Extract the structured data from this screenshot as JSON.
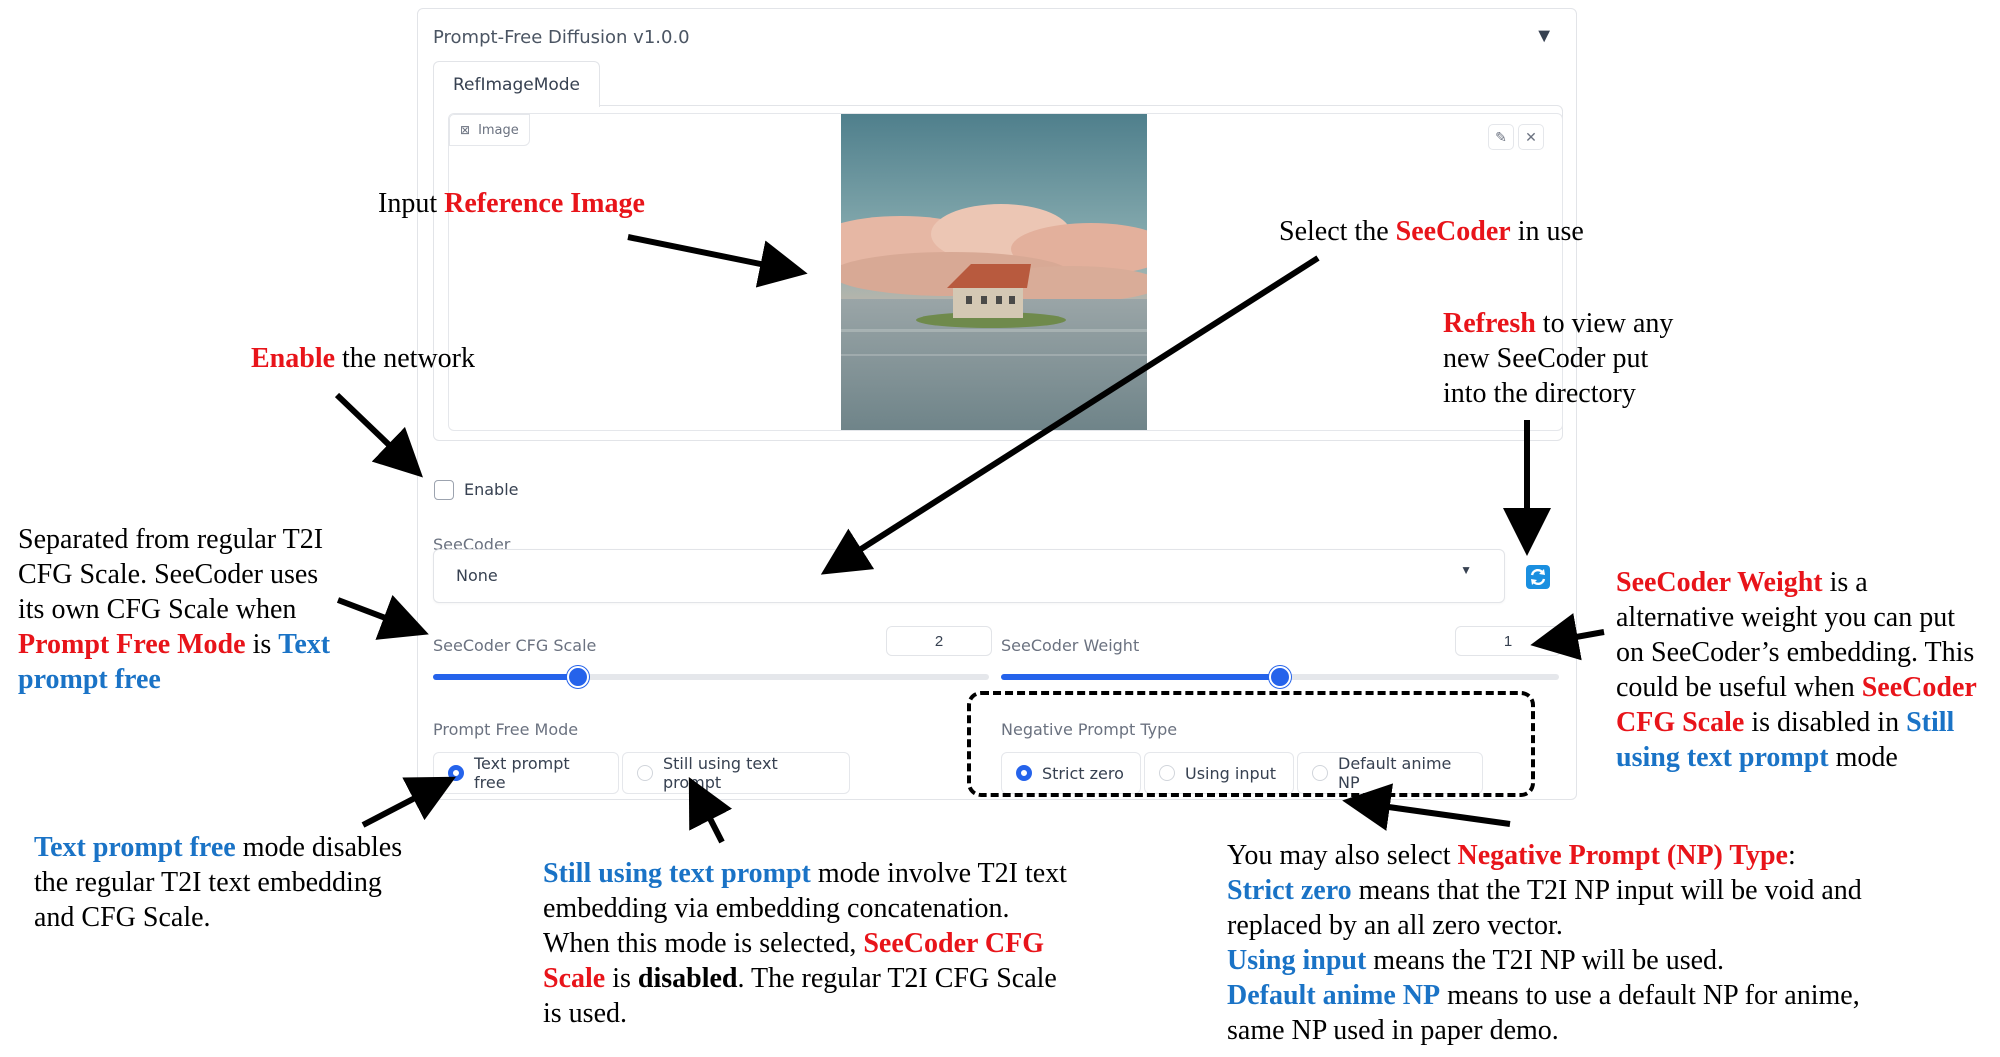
{
  "panel": {
    "title": "Prompt-Free Diffusion v1.0.0",
    "collapse_icon": "triangle-down-icon",
    "tab_label": "RefImageMode",
    "image_label": "Image",
    "enable_label": "Enable",
    "seecoder_label": "SeeCoder",
    "seecoder_value": "None",
    "cfg_label": "SeeCoder CFG Scale",
    "cfg_value": "2",
    "weight_label": "SeeCoder Weight",
    "weight_value": "1",
    "cfg_slider_fraction": 0.26,
    "weight_slider_fraction": 0.5,
    "prompt_mode_label": "Prompt Free Mode",
    "prompt_mode_options": [
      "Text prompt free",
      "Still using text prompt"
    ],
    "prompt_mode_selected": "Text prompt free",
    "np_label": "Negative Prompt Type",
    "np_options": [
      "Strict zero",
      "Using input",
      "Default anime NP"
    ],
    "np_selected": "Strict zero",
    "accent_color": "#2563eb"
  },
  "annotations": {
    "ref_image": {
      "a": "Input ",
      "b": "Reference Image"
    },
    "seecoder": {
      "a": "Select the ",
      "b": "SeeCoder",
      "c": " in use"
    },
    "refresh": {
      "a": "Refresh",
      "b": " to view any",
      "c": "new SeeCoder put",
      "d": "into the directory"
    },
    "enable": {
      "a": "Enable",
      "b": " the network"
    },
    "cfg": {
      "l1": "Separated from regular T2I",
      "l2": "CFG Scale. SeeCoder uses",
      "l3": "its own CFG Scale when",
      "l4a": "Prompt Free Mode",
      "l4b": " is ",
      "l4c": "Text",
      "l5": "prompt free"
    },
    "weight": {
      "l1a": "SeeCoder Weight",
      "l1b": " is a",
      "l2": "alternative weight you can put",
      "l3": "on SeeCoder’s embedding. This",
      "l4a": "could be useful when ",
      "l4b": "SeeCoder",
      "l5a": "CFG Scale",
      "l5b": " is disabled in ",
      "l5c": "Still",
      "l6a": "using text prompt",
      "l6b": " mode"
    },
    "text_free": {
      "l1a": "Text prompt free",
      "l1b": " mode disables",
      "l2": "the regular T2I text embedding",
      "l3": "and CFG Scale."
    },
    "still_using": {
      "l1a": "Still using text prompt",
      "l1b": " mode involve T2I text",
      "l2": "embedding via embedding concatenation.",
      "l3": "When this mode is selected, ",
      "l3b": "SeeCoder CFG",
      "l4a": "Scale",
      "l4b": " is ",
      "l4c": "disabled",
      "l4d": ". The regular  T2I CFG Scale",
      "l5": "is used."
    },
    "np": {
      "l1a": "You may also select ",
      "l1b": "Negative Prompt (NP) Type",
      "l1c": ":",
      "l2a": "Strict zero",
      "l2b": " means that the T2I NP input will be void and",
      "l3": "replaced by an all zero vector.",
      "l4a": "Using input",
      "l4b": " means the T2I NP will be used.",
      "l5a": "Default anime NP",
      "l5b": " means to use a default NP for anime,",
      "l6": "same NP used in paper demo."
    }
  }
}
